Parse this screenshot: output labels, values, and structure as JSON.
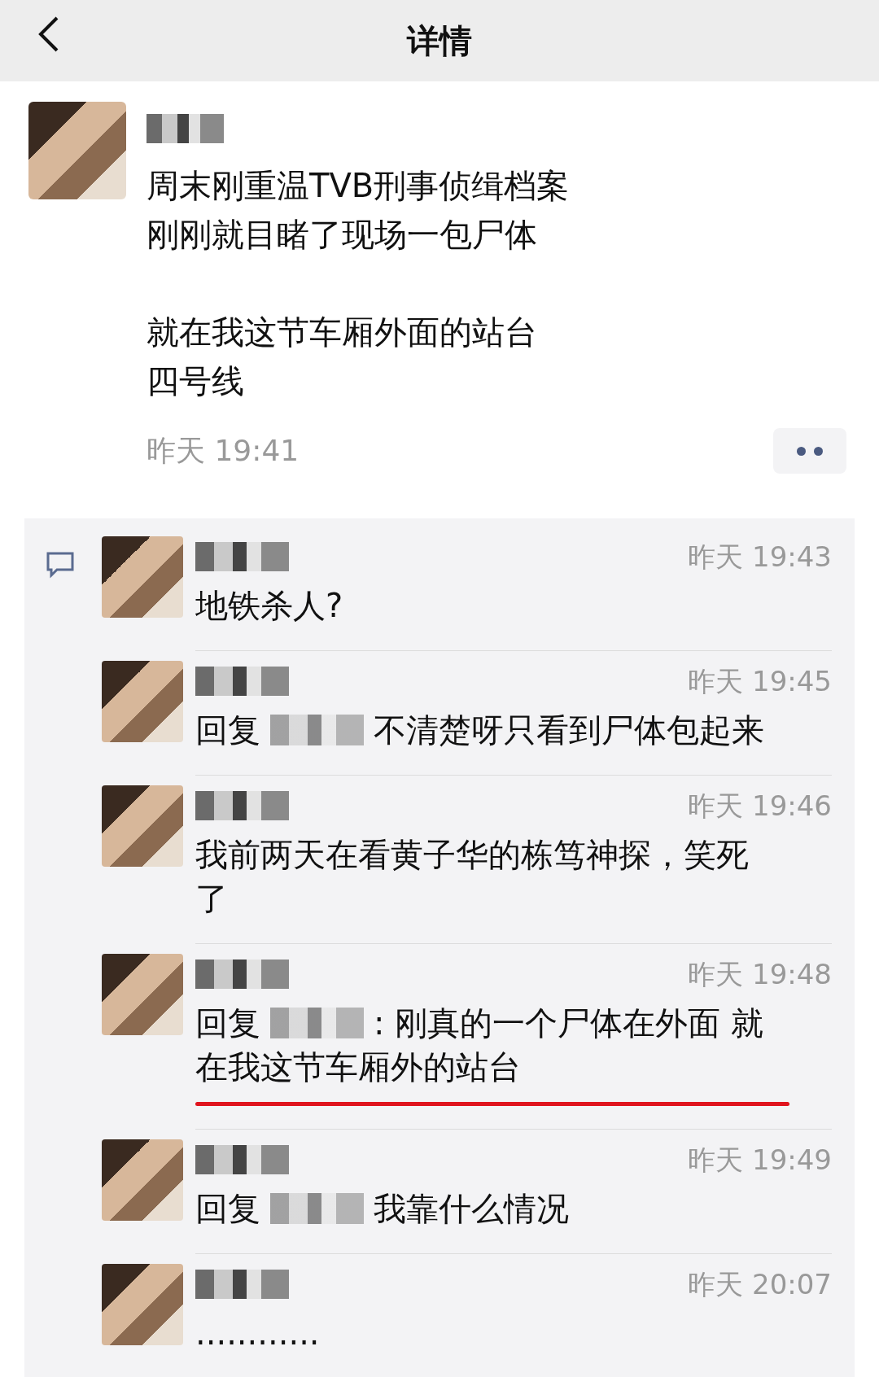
{
  "header": {
    "title": "详情"
  },
  "post": {
    "paragraphs": [
      [
        "周末刚重温TVB刑事侦缉档案",
        "刚刚就目睹了现场一包尸体"
      ],
      [
        "就在我这节车厢外面的站台",
        "四号线"
      ]
    ],
    "time": "昨天 19:41"
  },
  "comments": [
    {
      "time": "昨天 19:43",
      "lines": [
        "地铁杀人?"
      ],
      "underlined": false
    },
    {
      "time": "昨天 19:45",
      "reply_label": "回复",
      "lines": [
        "不清楚呀只看到尸体包起来"
      ],
      "underlined": false
    },
    {
      "time": "昨天 19:46",
      "lines": [
        "我前两天在看黄子华的栋笃神探，笑死",
        "了"
      ],
      "underlined": false
    },
    {
      "time": "昨天 19:48",
      "reply_label": "回复",
      "lines": [
        ": 刚真的一个尸体在外面 就",
        "在我这节车厢外的站台"
      ],
      "underlined": true
    },
    {
      "time": "昨天 19:49",
      "reply_label": "回复",
      "lines": [
        "我靠什么情况"
      ],
      "underlined": false
    },
    {
      "time": "昨天 20:07",
      "lines": [
        "............"
      ],
      "underlined": false
    }
  ]
}
